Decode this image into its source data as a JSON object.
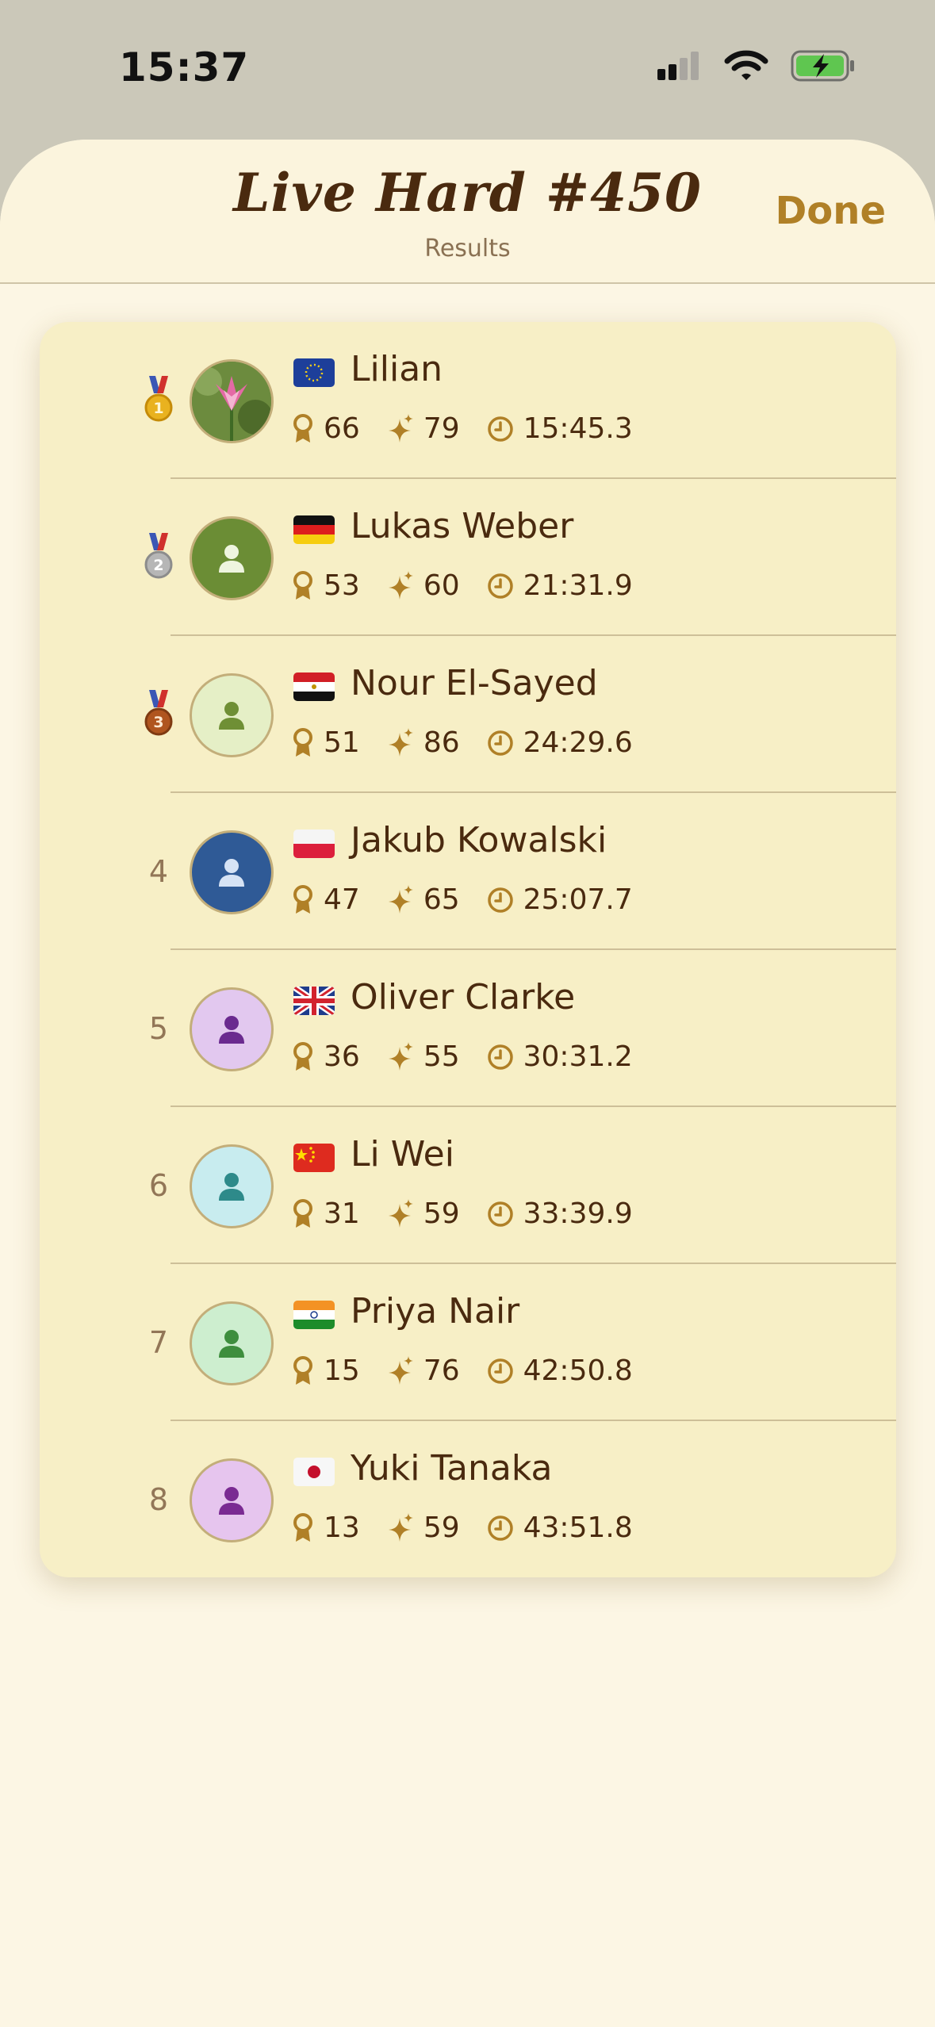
{
  "status_bar": {
    "time": "15:37"
  },
  "header": {
    "title": "Live Hard #450",
    "subtitle": "Results",
    "done_label": "Done"
  },
  "players": [
    {
      "rank": "1",
      "name": "Lilian",
      "flag": "EU",
      "score": "66",
      "sparkles": "79",
      "time": "15:45.3",
      "avatar": "tulip-photo"
    },
    {
      "rank": "2",
      "name": "Lukas Weber",
      "flag": "DE",
      "score": "53",
      "sparkles": "60",
      "time": "21:31.9",
      "avatar": "person"
    },
    {
      "rank": "3",
      "name": "Nour El-Sayed",
      "flag": "EG",
      "score": "51",
      "sparkles": "86",
      "time": "24:29.6",
      "avatar": "person"
    },
    {
      "rank": "4",
      "name": "Jakub Kowalski",
      "flag": "PL",
      "score": "47",
      "sparkles": "65",
      "time": "25:07.7",
      "avatar": "person"
    },
    {
      "rank": "5",
      "name": "Oliver Clarke",
      "flag": "GB",
      "score": "36",
      "sparkles": "55",
      "time": "30:31.2",
      "avatar": "person"
    },
    {
      "rank": "6",
      "name": "Li Wei",
      "flag": "CN",
      "score": "31",
      "sparkles": "59",
      "time": "33:39.9",
      "avatar": "person"
    },
    {
      "rank": "7",
      "name": "Priya Nair",
      "flag": "IN",
      "score": "15",
      "sparkles": "76",
      "time": "42:50.8",
      "avatar": "person"
    },
    {
      "rank": "8",
      "name": "Yuki Tanaka",
      "flag": "JP",
      "score": "13",
      "sparkles": "59",
      "time": "43:51.8",
      "avatar": "person"
    }
  ],
  "colors": {
    "accent": "#b08027",
    "text": "#4a2a0f",
    "card": "#f7efc6",
    "sheet": "#fcf6e4"
  }
}
